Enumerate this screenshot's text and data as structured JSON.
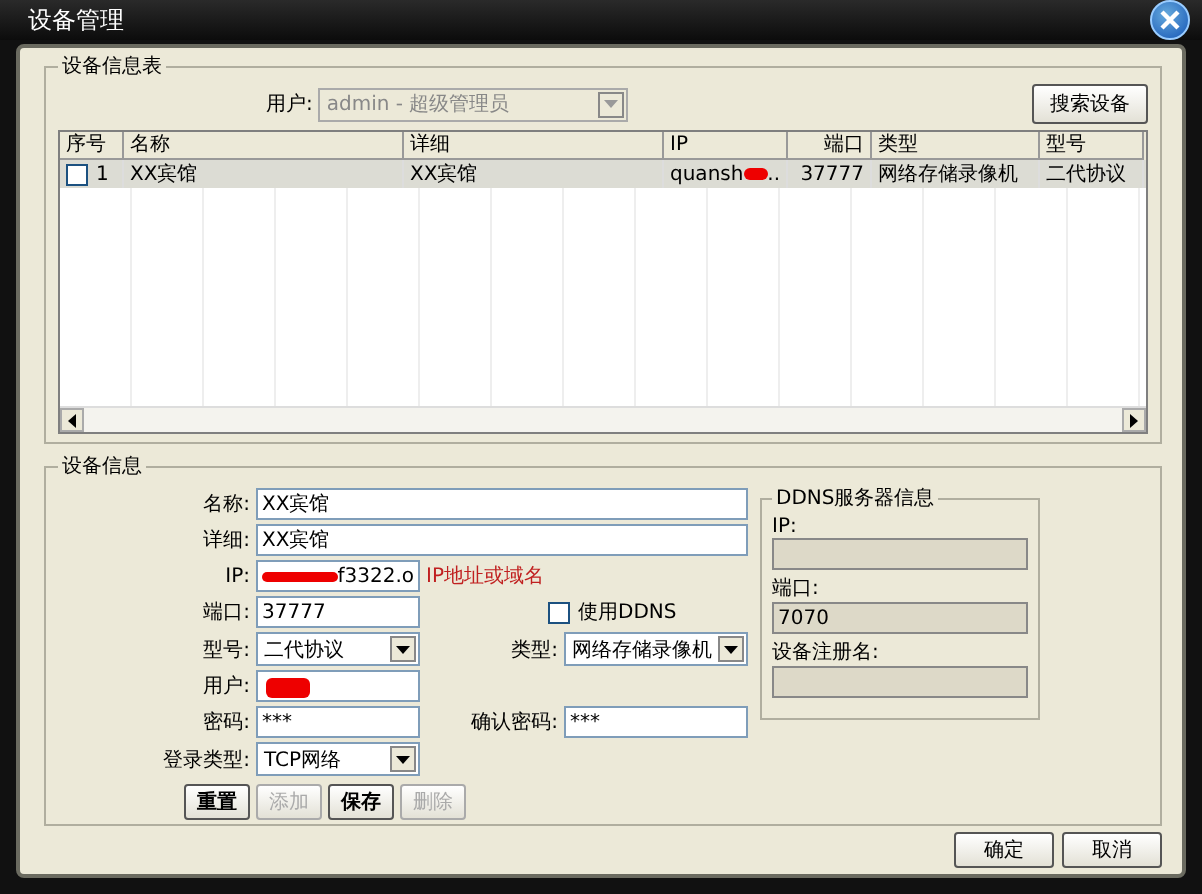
{
  "window": {
    "title": "设备管理"
  },
  "device_table_group": {
    "title": "设备信息表",
    "user_label": "用户:",
    "user_value": "admin - 超级管理员",
    "user_disabled": true,
    "search_button": "搜索设备"
  },
  "table": {
    "columns": [
      "序号",
      "名称",
      "详细",
      "IP",
      "端口",
      "类型",
      "型号"
    ],
    "rows": [
      {
        "checked": false,
        "selected": true,
        "index": "1",
        "name": "XX宾馆",
        "detail": "XX宾馆",
        "ip": "quansh",
        "ip_tail": "..",
        "port": "37777",
        "type": "网络存储录像机",
        "model": "二代协议"
      }
    ]
  },
  "device_info": {
    "title": "设备信息",
    "name_label": "名称:",
    "name_value": "XX宾馆",
    "detail_label": "详细:",
    "detail_value": "XX宾馆",
    "ip_label": "IP:",
    "ip_value": "f3322.o",
    "ip_hint": "IP地址或域名",
    "port_label": "端口:",
    "port_value": "37777",
    "use_ddns": {
      "label": "使用DDNS",
      "checked": false
    },
    "model_label": "型号:",
    "model_value": "二代协议",
    "type_label": "类型:",
    "type_value": "网络存储录像机",
    "user_label": "用户:",
    "password_label": "密码:",
    "password_value": "***",
    "confirm_label": "确认密码:",
    "confirm_value": "***",
    "login_label": "登录类型:",
    "login_value": "TCP网络",
    "buttons": [
      {
        "label": "重置",
        "disabled": false
      },
      {
        "label": "添加",
        "disabled": true
      },
      {
        "label": "保存",
        "disabled": false
      },
      {
        "label": "删除",
        "disabled": true
      }
    ]
  },
  "ddns": {
    "title": "DDNS服务器信息",
    "ip_label": "IP:",
    "port_label": "端口:",
    "port_value": "7070",
    "reg_label": "设备注册名:"
  },
  "footer_buttons": [
    "确定",
    "取消"
  ]
}
